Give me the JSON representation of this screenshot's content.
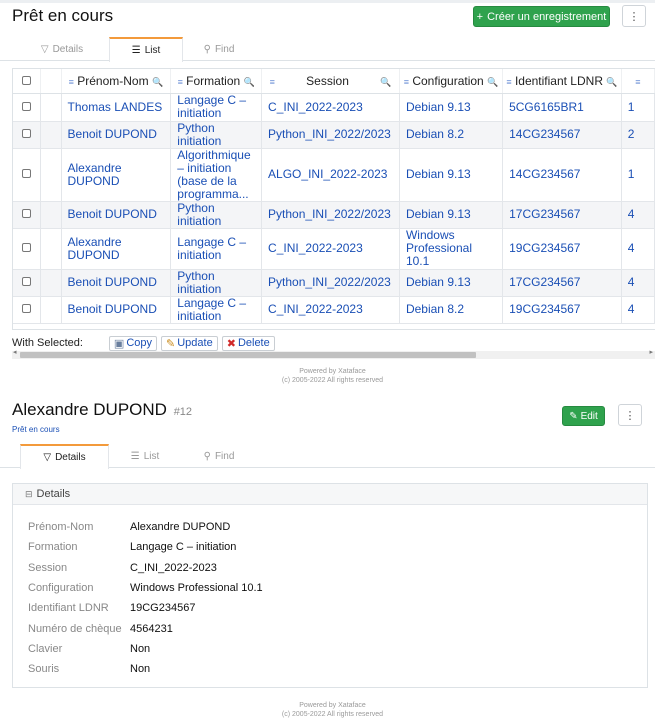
{
  "list_page": {
    "title": "Prêt en cours",
    "new_button_label": "Créer un enregistrement",
    "tabs": [
      {
        "label": "Details",
        "icon": "details-icon",
        "active": false
      },
      {
        "label": "List",
        "icon": "list-icon",
        "active": true
      },
      {
        "label": "Find",
        "icon": "search-icon",
        "active": false
      }
    ],
    "columns": [
      "Prénom-Nom",
      "Formation",
      "Session",
      "Configuration",
      "Identifiant LDNR"
    ],
    "rows": [
      {
        "nom": "Thomas LANDES",
        "formation": "Langage C – initiation",
        "session": "C_INI_2022-2023",
        "config": "Debian 9.13",
        "id": "5CG6165BR1",
        "extra": "1"
      },
      {
        "nom": "Benoit DUPOND",
        "formation": "Python initiation",
        "session": "Python_INI_2022/2023",
        "config": "Debian 8.2",
        "id": "14CG234567",
        "extra": "2"
      },
      {
        "nom": "Alexandre DUPOND",
        "formation": "Algorithmique – initiation (base de la programma...",
        "session": "ALGO_INI_2022-2023",
        "config": "Debian 9.13",
        "id": "14CG234567",
        "extra": "1"
      },
      {
        "nom": "Benoit DUPOND",
        "formation": "Python initiation",
        "session": "Python_INI_2022/2023",
        "config": "Debian 9.13",
        "id": "17CG234567",
        "extra": "4"
      },
      {
        "nom": "Alexandre DUPOND",
        "formation": "Langage C – initiation",
        "session": "C_INI_2022-2023",
        "config": "Windows Professional 10.1",
        "id": "19CG234567",
        "extra": "4"
      },
      {
        "nom": "Benoit DUPOND",
        "formation": "Python initiation",
        "session": "Python_INI_2022/2023",
        "config": "Debian 9.13",
        "id": "17CG234567",
        "extra": "4"
      },
      {
        "nom": "Benoit DUPOND",
        "formation": "Langage C – initiation",
        "session": "C_INI_2022-2023",
        "config": "Debian 8.2",
        "id": "19CG234567",
        "extra": "4"
      }
    ],
    "with_selected_label": "With Selected:",
    "actions": {
      "copy": "Copy",
      "update": "Update",
      "delete": "Delete"
    },
    "footer_line1": "Powered by Xataface",
    "footer_line2": "(c) 2005-2022 All rights reserved"
  },
  "detail_page": {
    "title": "Alexandre DUPOND",
    "record_id": "#12",
    "breadcrumb": "Prêt en cours",
    "edit_label": "Edit",
    "tabs": [
      {
        "label": "Details",
        "active": true
      },
      {
        "label": "List",
        "active": false
      },
      {
        "label": "Find",
        "active": false
      }
    ],
    "panel_title": "Details",
    "fields": [
      {
        "label": "Prénom-Nom",
        "value": "Alexandre DUPOND"
      },
      {
        "label": "Formation",
        "value": "Langage C – initiation"
      },
      {
        "label": "Session",
        "value": "C_INI_2022-2023"
      },
      {
        "label": "Configuration",
        "value": "Windows Professional 10.1"
      },
      {
        "label": "Identifiant LDNR",
        "value": "19CG234567"
      },
      {
        "label": "Numéro de chèque",
        "value": "4564231"
      },
      {
        "label": "Clavier",
        "value": "Non"
      },
      {
        "label": "Souris",
        "value": "Non"
      }
    ],
    "footer_line1": "Powered by Xataface",
    "footer_line2": "(c) 2005-2022 All rights reserved"
  },
  "colors": {
    "accent_green": "#2fa24d",
    "link_blue": "#1a4fb5",
    "tab_active": "#f39a3b"
  }
}
